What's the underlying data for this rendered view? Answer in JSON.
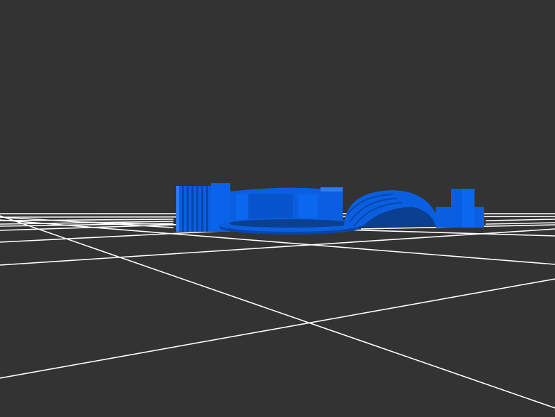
{
  "viewport": {
    "background": "#333333",
    "grid_color": "#ffffff",
    "model_color": "#0a5fe0",
    "model_shadow": "#0847a8",
    "model_highlight": "#2f7df5"
  },
  "scene": {
    "view": "3d-perspective",
    "ground_grid": "on",
    "objects": [
      {
        "name": "ribbed-block"
      },
      {
        "name": "arc-wall-block"
      },
      {
        "name": "flat-disc"
      },
      {
        "name": "ribbed-dome"
      },
      {
        "name": "stepped-block"
      }
    ]
  }
}
